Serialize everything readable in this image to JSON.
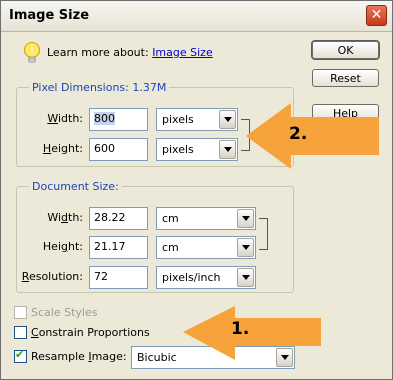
{
  "window": {
    "title": "Image Size"
  },
  "learn": {
    "prefix": "Learn more about:",
    "link": "Image Size"
  },
  "buttons": {
    "ok": "OK",
    "reset": "Reset",
    "help": "Help"
  },
  "pixel_dimensions": {
    "legend": "Pixel Dimensions:",
    "size": "1.37M",
    "width_label": "Width:",
    "width_value": "800",
    "width_unit": "pixels",
    "height_label": "Height:",
    "height_value": "600",
    "height_unit": "pixels"
  },
  "document_size": {
    "legend": "Document Size:",
    "width_label": "Width:",
    "width_value": "28.22",
    "width_unit": "cm",
    "height_label": "Height:",
    "height_value": "21.17",
    "height_unit": "cm",
    "resolution_label": "Resolution:",
    "resolution_value": "72",
    "resolution_unit": "pixels/inch"
  },
  "options": {
    "scale_styles": "Scale Styles",
    "constrain": "Constrain Proportions",
    "resample": "Resample Image:",
    "resample_method": "Bicubic",
    "scale_styles_checked": false,
    "constrain_checked": false,
    "resample_checked": true
  },
  "annotations": {
    "one": "1.",
    "two": "2."
  },
  "colors": {
    "arrow": "#f5a33a",
    "legend": "#1a44b8",
    "link": "#0000cc"
  }
}
